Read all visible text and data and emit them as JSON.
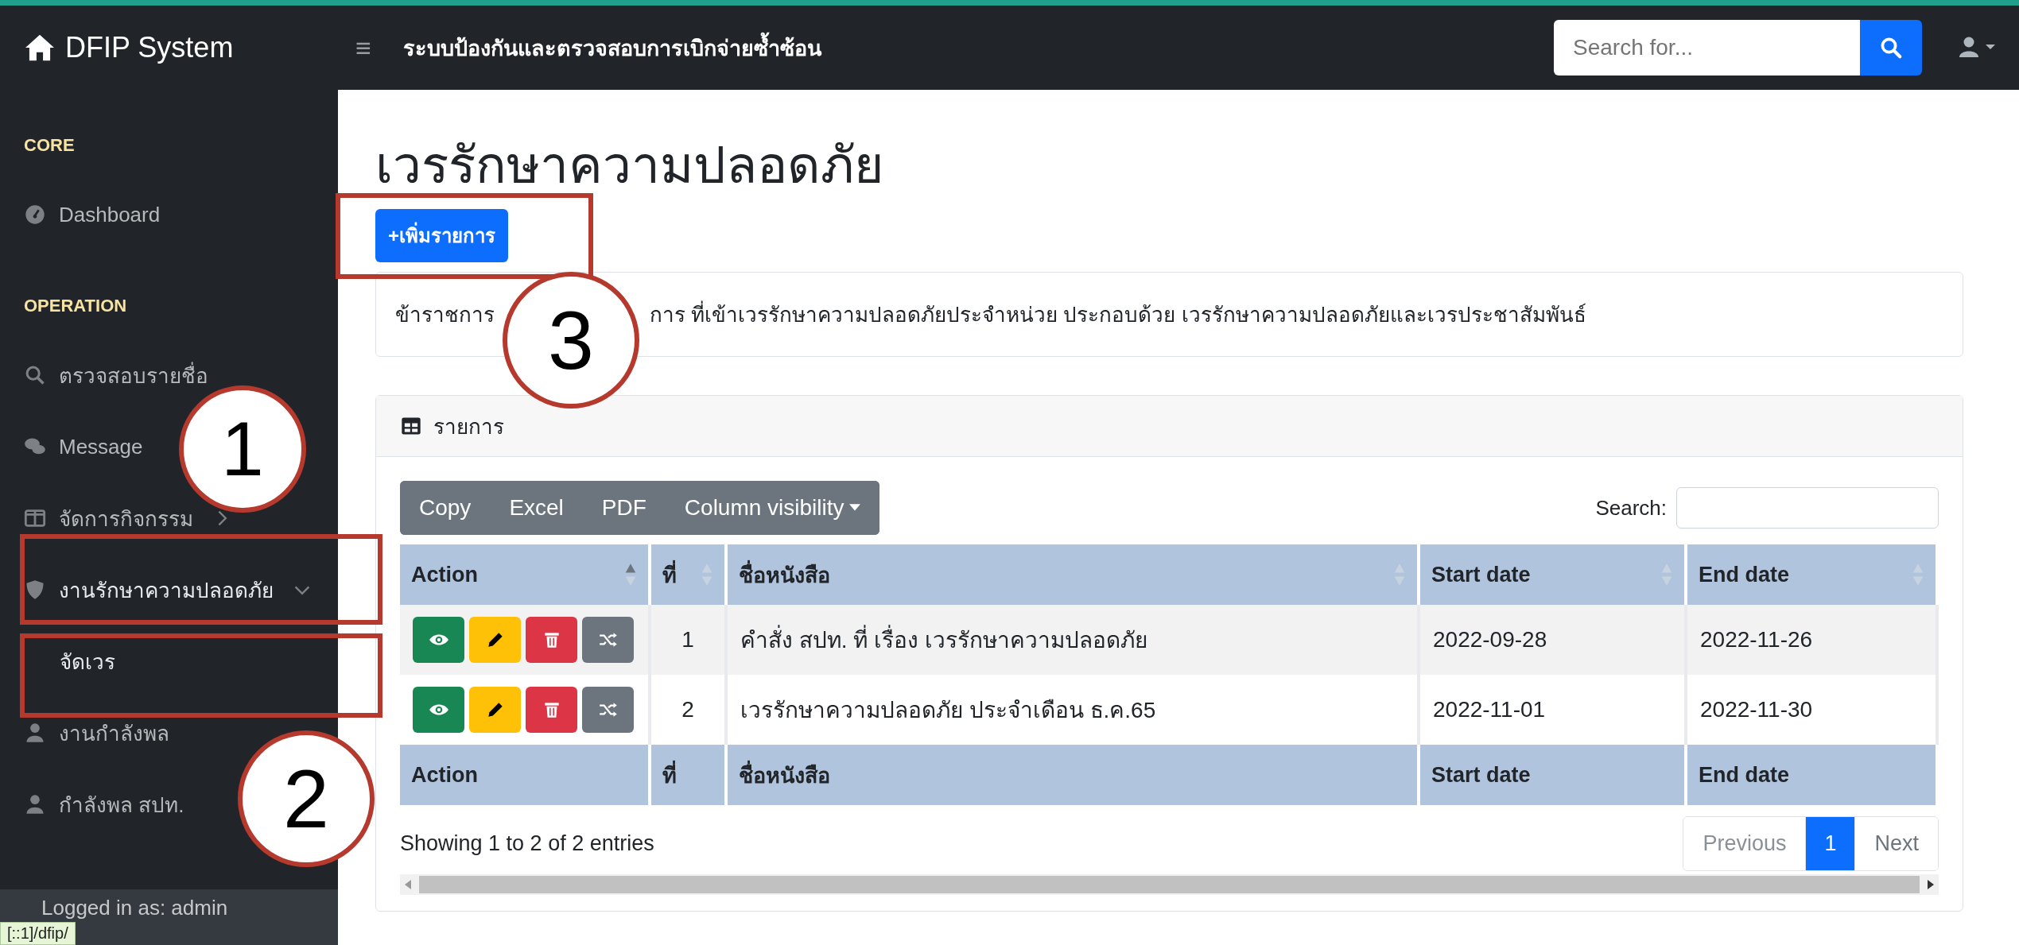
{
  "navbar": {
    "brand": "DFIP System",
    "menu_glyph": "≡",
    "title": "ระบบป้องกันและตรวจสอบการเบิกจ่ายซ้ำซ้อน",
    "search": {
      "placeholder": "Search for..."
    }
  },
  "sidebar": {
    "sections": [
      {
        "heading": "CORE",
        "items": [
          {
            "label": "Dashboard",
            "kind": "gauge"
          }
        ]
      },
      {
        "heading": "OPERATION",
        "items": [
          {
            "label": "ตรวจสอบรายชื่อ",
            "kind": "search"
          },
          {
            "label": "Message",
            "kind": "chat"
          },
          {
            "label": "จัดการกิจกรรม",
            "kind": "columns",
            "expanded": false
          },
          {
            "label": "งานรักษาความปลอดภัย",
            "kind": "shield",
            "expanded": true,
            "children": [
              {
                "label": "จัดเวร"
              }
            ]
          },
          {
            "label": "งานกำลังพล",
            "kind": "user"
          },
          {
            "label": "กำลังพล สปท.",
            "kind": "user"
          }
        ]
      }
    ],
    "footer": "Logged in as: admin"
  },
  "page": {
    "heading": "เวรรักษาความปลอดภัย",
    "add_button": "+เพิ่มรายการ",
    "description_parts": [
      "ข้าราชการ",
      "การ ที่เข้าเวรรักษาความปลอดภัยประจำหน่วย ประกอบด้วย เวรรักษาความปลอดภัยและเวรประชาสัมพันธ์"
    ]
  },
  "table_card": {
    "title": "รายการ",
    "toolbar": [
      {
        "label": "Copy",
        "kind": "plain"
      },
      {
        "label": "Excel",
        "kind": "plain"
      },
      {
        "label": "PDF",
        "kind": "plain"
      },
      {
        "label": "Column visibility",
        "kind": "dropdown"
      }
    ],
    "search_label": "Search:",
    "columns": [
      {
        "label": "Action",
        "sorted": true
      },
      {
        "label": "ที่",
        "sorted": false
      },
      {
        "label": "ชื่อหนังสือ",
        "sorted": false
      },
      {
        "label": "Start date",
        "sorted": false
      },
      {
        "label": "End date",
        "sorted": false
      }
    ],
    "rows": [
      {
        "actions": [
          {
            "kind": "view"
          },
          {
            "kind": "edit"
          },
          {
            "kind": "delete"
          },
          {
            "kind": "shuffle"
          }
        ],
        "no": "1",
        "title": "คำสั่ง สปท. ที่ เรื่อง เวรรักษาความปลอดภัย",
        "start": "2022-09-28",
        "end": "2022-11-26"
      },
      {
        "actions": [
          {
            "kind": "view"
          },
          {
            "kind": "edit"
          },
          {
            "kind": "delete"
          },
          {
            "kind": "shuffle"
          }
        ],
        "no": "2",
        "title": "เวรรักษาความปลอดภัย ประจำเดือน ธ.ค.65",
        "start": "2022-11-01",
        "end": "2022-11-30"
      }
    ],
    "footer_columns": [
      "Action",
      "ที่",
      "ชื่อหนังสือ",
      "Start date",
      "End date"
    ],
    "info": "Showing 1 to 2 of 2 entries",
    "pagination": [
      {
        "label": "Previous",
        "kind": "prev",
        "disabled": true,
        "selected": false
      },
      {
        "label": "1",
        "kind": "page",
        "disabled": false,
        "selected": true
      },
      {
        "label": "Next",
        "kind": "next",
        "disabled": false,
        "selected": false
      }
    ]
  },
  "callouts": [
    {
      "number": "1"
    },
    {
      "number": "2"
    },
    {
      "number": "3"
    }
  ],
  "status_bar": "[::1]/dfip/"
}
